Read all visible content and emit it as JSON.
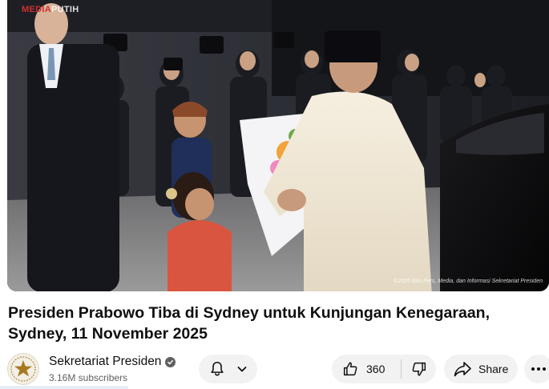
{
  "video": {
    "watermark_top_red": "MEDIA",
    "watermark_top_white": "PUTIH",
    "watermark_bottom": "©2025 Biro Pers, Media, dan Informasi Sekretariat Presiden"
  },
  "title": "Presiden Prabowo Tiba di Sydney untuk Kunjungan Kenegaraan, Sydney, 11 November 2025",
  "channel": {
    "name": "Sekretariat Presiden",
    "subscribers": "3.16M subscribers",
    "verified": true
  },
  "actions": {
    "like_count": "360",
    "share_label": "Share"
  },
  "icons": {
    "avatar": "garuda-star-emblem-icon",
    "verified": "check-badge-icon",
    "bell": "bell-icon",
    "chevron": "chevron-down-icon",
    "like": "thumbs-up-icon",
    "dislike": "thumbs-down-icon",
    "share": "share-arrow-icon",
    "more": "more-horizontal-icon"
  },
  "colors": {
    "accent_red": "#d32f2f",
    "pill_bg": "#f2f2f2",
    "secondary_text": "#606060"
  }
}
